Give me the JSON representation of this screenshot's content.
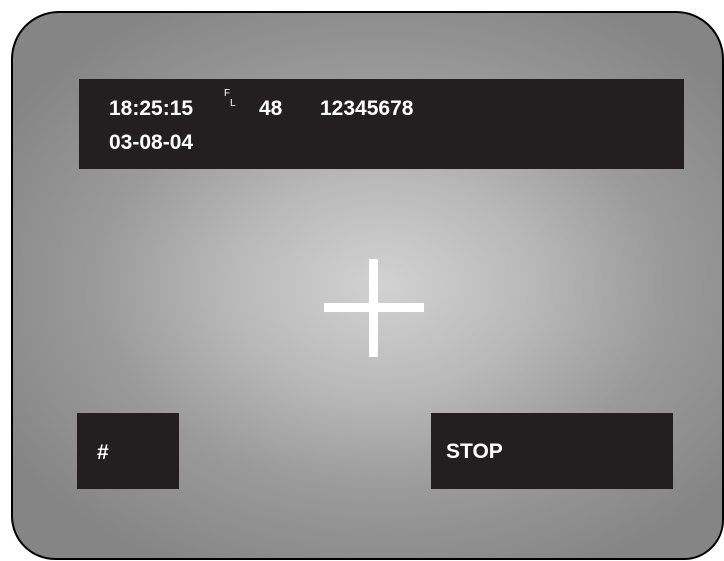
{
  "overlay": {
    "time": "18:25:15",
    "field_top": "F",
    "field_bottom": "L",
    "channel": "48",
    "camera_id": "12345678",
    "date": "03-08-04"
  },
  "crosshair": {
    "icon": "crosshair-icon",
    "color": "#ffffff"
  },
  "buttons": {
    "hash_label": "#",
    "stop_label": "STOP"
  },
  "colors": {
    "panel": "#231f20",
    "text": "#ffffff",
    "screen_center": "#d2d2d2",
    "screen_edge": "#858585"
  }
}
